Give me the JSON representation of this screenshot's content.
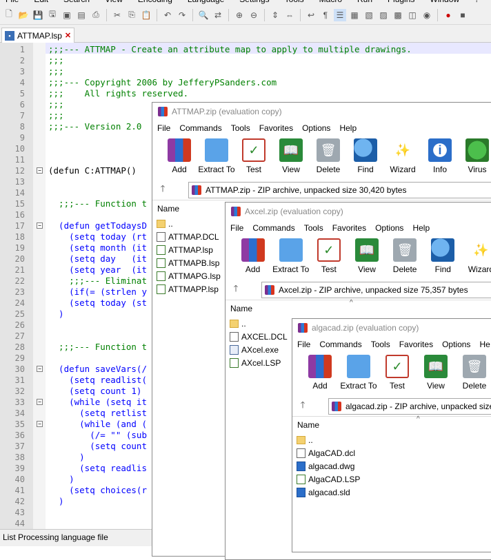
{
  "app": {
    "menu": [
      "File",
      "Edit",
      "Search",
      "View",
      "Encoding",
      "Language",
      "Settings",
      "Tools",
      "Macro",
      "Run",
      "Plugins",
      "Window",
      "?"
    ]
  },
  "tab": {
    "label": "ATTMAP.lsp"
  },
  "editor": {
    "lines": [
      {
        "n": "1",
        "text": ";;;--- ATTMAP - Create an attribute map to apply to multiple drawings.",
        "cls": "c-comment"
      },
      {
        "n": "2",
        "text": ";;;",
        "cls": "c-comment"
      },
      {
        "n": "3",
        "text": ";;;",
        "cls": "c-comment"
      },
      {
        "n": "4",
        "text": ";;;--- Copyright 2006 by JefferyPSanders.com",
        "cls": "c-comment"
      },
      {
        "n": "5",
        "text": ";;;    All rights reserved.",
        "cls": "c-comment"
      },
      {
        "n": "6",
        "text": ";;;",
        "cls": "c-comment"
      },
      {
        "n": "7",
        "text": ";;;",
        "cls": "c-comment"
      },
      {
        "n": "8",
        "text": ";;;--- Version 2.0",
        "cls": "c-comment"
      },
      {
        "n": "9",
        "text": "",
        "cls": "c-plain"
      },
      {
        "n": "10",
        "text": "",
        "cls": "c-plain"
      },
      {
        "n": "11",
        "text": "",
        "cls": "c-plain"
      },
      {
        "n": "12",
        "text": "(defun C:ATTMAP()",
        "cls": "c-plain",
        "fold": true
      },
      {
        "n": "13",
        "text": "",
        "cls": "c-plain"
      },
      {
        "n": "14",
        "text": "",
        "cls": "c-plain"
      },
      {
        "n": "15",
        "text": "  ;;;--- Function t",
        "cls": "c-comment"
      },
      {
        "n": "16",
        "text": "",
        "cls": "c-plain"
      },
      {
        "n": "17",
        "text": "  (defun getTodaysD",
        "cls": "c-kw",
        "fold": true
      },
      {
        "n": "18",
        "text": "    (setq today (rt",
        "cls": "c-kw"
      },
      {
        "n": "19",
        "text": "    (setq month (it",
        "cls": "c-kw"
      },
      {
        "n": "20",
        "text": "    (setq day   (it",
        "cls": "c-kw"
      },
      {
        "n": "21",
        "text": "    (setq year  (it",
        "cls": "c-kw"
      },
      {
        "n": "22",
        "text": "    ;;;--- Eliminat",
        "cls": "c-comment"
      },
      {
        "n": "23",
        "text": "    (if(= (strlen y",
        "cls": "c-kw"
      },
      {
        "n": "24",
        "text": "    (setq today (st",
        "cls": "c-kw"
      },
      {
        "n": "25",
        "text": "  )",
        "cls": "c-kw"
      },
      {
        "n": "26",
        "text": "",
        "cls": "c-plain"
      },
      {
        "n": "27",
        "text": "",
        "cls": "c-plain"
      },
      {
        "n": "28",
        "text": "  ;;;--- Function t",
        "cls": "c-comment"
      },
      {
        "n": "29",
        "text": "",
        "cls": "c-plain"
      },
      {
        "n": "30",
        "text": "  (defun saveVars(/",
        "cls": "c-kw",
        "fold": true
      },
      {
        "n": "31",
        "text": "    (setq readlist(",
        "cls": "c-kw"
      },
      {
        "n": "32",
        "text": "    (setq count 1)",
        "cls": "c-kw"
      },
      {
        "n": "33",
        "text": "    (while (setq it",
        "cls": "c-kw",
        "fold": true
      },
      {
        "n": "34",
        "text": "      (setq retlist",
        "cls": "c-kw"
      },
      {
        "n": "35",
        "text": "      (while (and (",
        "cls": "c-kw",
        "fold": true
      },
      {
        "n": "36",
        "text": "        (/= \"\" (sub",
        "cls": "c-kw"
      },
      {
        "n": "37",
        "text": "        (setq count",
        "cls": "c-kw"
      },
      {
        "n": "38",
        "text": "      )",
        "cls": "c-kw"
      },
      {
        "n": "39",
        "text": "      (setq readlis",
        "cls": "c-kw"
      },
      {
        "n": "40",
        "text": "    )",
        "cls": "c-kw"
      },
      {
        "n": "41",
        "text": "    (setq choices(r",
        "cls": "c-kw"
      },
      {
        "n": "42",
        "text": "  )",
        "cls": "c-kw"
      },
      {
        "n": "43",
        "text": "",
        "cls": "c-plain"
      },
      {
        "n": "44",
        "text": "",
        "cls": "c-plain"
      }
    ]
  },
  "status": {
    "text": "List Processing language file"
  },
  "windows": [
    {
      "id": "attmap",
      "title": "ATTMAP.zip (evaluation copy)",
      "menu": [
        "File",
        "Commands",
        "Tools",
        "Favorites",
        "Options",
        "Help"
      ],
      "tools": [
        {
          "label": "Add",
          "icon": "add-icon"
        },
        {
          "label": "Extract To",
          "icon": "extract-icon"
        },
        {
          "label": "Test",
          "icon": "test-icon"
        },
        {
          "label": "View",
          "icon": "view-icon"
        },
        {
          "label": "Delete",
          "icon": "delete-icon"
        },
        {
          "label": "Find",
          "icon": "find-icon"
        },
        {
          "label": "Wizard",
          "icon": "wizard-icon"
        },
        {
          "label": "Info",
          "icon": "info-icon"
        },
        {
          "label": "Virus",
          "icon": "virus-icon"
        }
      ],
      "path": "ATTMAP.zip - ZIP archive, unpacked size 30,420 bytes",
      "col": "Name",
      "files": [
        {
          "name": "..",
          "type": "folder"
        },
        {
          "name": "ATTMAP.DCL",
          "type": "file"
        },
        {
          "name": "ATTMAP.lsp",
          "type": "lisp"
        },
        {
          "name": "ATTMAPB.lsp",
          "type": "lisp"
        },
        {
          "name": "ATTMAPG.lsp",
          "type": "lisp"
        },
        {
          "name": "ATTMAPP.lsp",
          "type": "lisp"
        }
      ]
    },
    {
      "id": "axcel",
      "title": "Axcel.zip (evaluation copy)",
      "menu": [
        "File",
        "Commands",
        "Tools",
        "Favorites",
        "Options",
        "Help"
      ],
      "tools": [
        {
          "label": "Add",
          "icon": "add-icon"
        },
        {
          "label": "Extract To",
          "icon": "extract-icon"
        },
        {
          "label": "Test",
          "icon": "test-icon"
        },
        {
          "label": "View",
          "icon": "view-icon"
        },
        {
          "label": "Delete",
          "icon": "delete-icon"
        },
        {
          "label": "Find",
          "icon": "find-icon"
        },
        {
          "label": "Wizard",
          "icon": "wizard-icon"
        }
      ],
      "path": "Axcel.zip - ZIP archive, unpacked size 75,357 bytes",
      "col": "Name",
      "files": [
        {
          "name": "..",
          "type": "folder"
        },
        {
          "name": "AXCEL.DCL",
          "type": "file"
        },
        {
          "name": "AXcel.exe",
          "type": "exe"
        },
        {
          "name": "AXcel.LSP",
          "type": "lisp"
        }
      ]
    },
    {
      "id": "algacad",
      "title": "algacad.zip (evaluation copy)",
      "menu": [
        "File",
        "Commands",
        "Tools",
        "Favorites",
        "Options",
        "He"
      ],
      "tools": [
        {
          "label": "Add",
          "icon": "add-icon"
        },
        {
          "label": "Extract To",
          "icon": "extract-icon"
        },
        {
          "label": "Test",
          "icon": "test-icon"
        },
        {
          "label": "View",
          "icon": "view-icon"
        },
        {
          "label": "Delete",
          "icon": "delete-icon"
        }
      ],
      "path": "algacad.zip - ZIP archive, unpacked size",
      "col": "Name",
      "files": [
        {
          "name": "..",
          "type": "folder"
        },
        {
          "name": "AlgaCAD.dcl",
          "type": "file"
        },
        {
          "name": "algacad.dwg",
          "type": "dwg"
        },
        {
          "name": "AlgaCAD.LSP",
          "type": "lisp"
        },
        {
          "name": "algacad.sld",
          "type": "dwg"
        }
      ]
    }
  ]
}
